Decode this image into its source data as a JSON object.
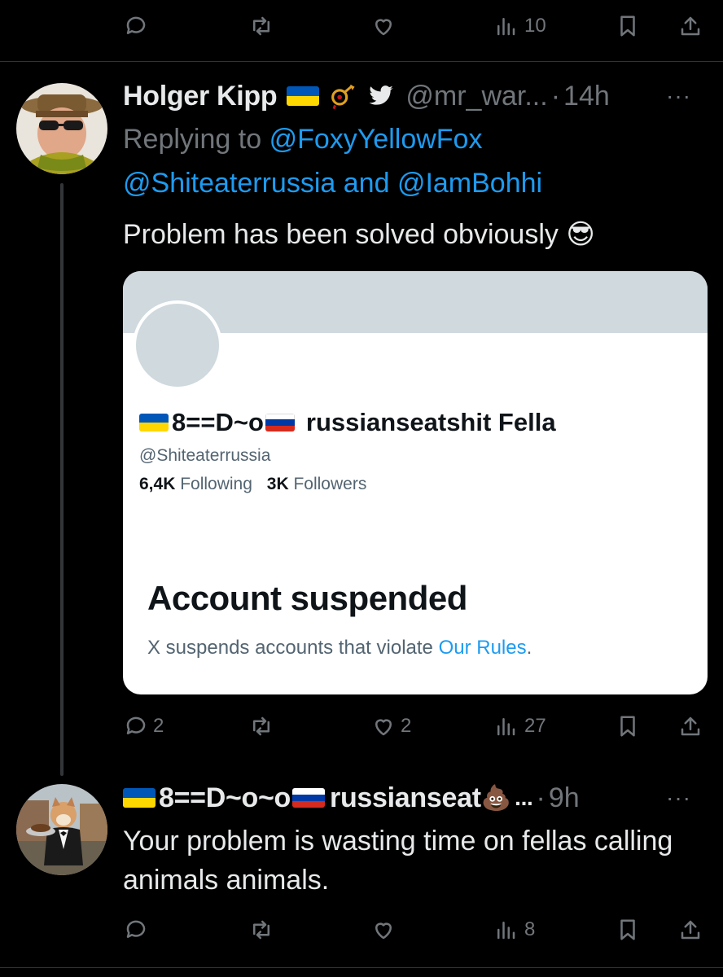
{
  "top_actions": {
    "views": "10"
  },
  "tweet1": {
    "name": "Holger Kipp",
    "handle": "@mr_war...",
    "dot": "·",
    "time": "14h",
    "more": "···",
    "replying_prefix": "Replying to",
    "mention1": "@FoxyYellowFox",
    "mention2": "@Shiteaterrussia",
    "and_word": "and",
    "mention3": "@IamBohhi",
    "text": "Problem has been solved obviously",
    "emoji": "😎",
    "actions": {
      "replies": "2",
      "likes": "2",
      "views": "27"
    }
  },
  "card": {
    "name_middle": "8==D~o",
    "name_rest": "russianseatshit Fella",
    "handle": "@Shiteaterrussia",
    "following_count": "6,4K",
    "following_label": "Following",
    "followers_count": "3K",
    "followers_label": "Followers",
    "title": "Account suspended",
    "sub_text": "X suspends accounts that violate",
    "sub_link": "Our Rules",
    "sub_end": "."
  },
  "tweet2": {
    "name_middle": "8==D~o~o",
    "name_rest": "russianseat",
    "emoji": "💩",
    "ellipsis": "...",
    "dot": "·",
    "time": "9h",
    "more": "···",
    "text": "Your problem is wasting time on fellas calling animals animals.",
    "actions": {
      "views": "8"
    }
  },
  "colors": {
    "background": "#000000",
    "text": "#e7e9ea",
    "muted": "#71767b",
    "accent": "#1d9bf0",
    "ukraine_blue": "#0057b7",
    "ukraine_yellow": "#ffd700"
  },
  "icons": [
    "reply-icon",
    "retweet-icon",
    "like-icon",
    "views-icon",
    "bookmark-icon",
    "share-icon",
    "verified-bird-icon",
    "post-horn-icon"
  ]
}
